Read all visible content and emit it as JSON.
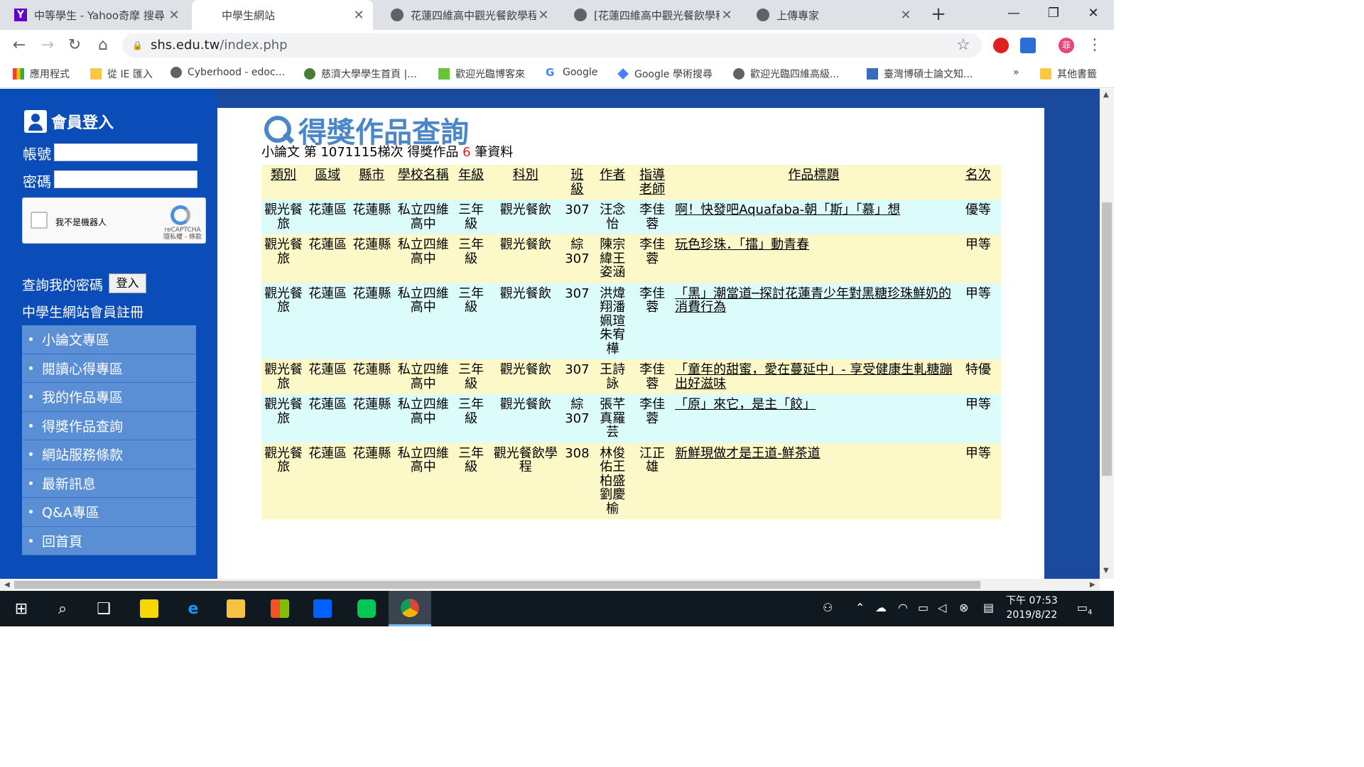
{
  "browser": {
    "tabs": [
      {
        "title": "中等學生 - Yahoo奇摩 搜尋",
        "icon": "yahoo-icon"
      },
      {
        "title": "中學生網站",
        "icon": "none"
      },
      {
        "title": "花蓮四維高中觀光餐飲學程",
        "icon": "globe-icon"
      },
      {
        "title": "[花蓮四維高中觀光餐飲學程",
        "icon": "globe-icon"
      },
      {
        "title": "上傳專家",
        "icon": "globe-icon"
      }
    ],
    "new_tab": "+",
    "url_domain": "shs.edu.tw",
    "url_path": "/index.php",
    "bookmarks": [
      "應用程式",
      "從 IE 匯入",
      "Cyberhood - edoc...",
      "慈濟大學學生首頁 |...",
      "歡迎光臨博客來",
      "Google",
      "Google 學術搜尋",
      "歡迎光臨四維高級...",
      "臺灣博碩士論文知...",
      "其他書籤"
    ],
    "bookmarks_more": "»",
    "profile_initial": "菲"
  },
  "sidebar": {
    "login_title": "會員登入",
    "account_label": "帳號",
    "password_label": "密碼",
    "captcha_text": "我不是機器人",
    "captcha_brand": "reCAPTCHA",
    "captcha_sub": "隱私權 - 條款",
    "forgot_text": "查詢我的密碼",
    "login_button": "登入",
    "register_text": "中學生網站會員註冊",
    "menu": [
      "小論文專區",
      "閱讀心得專區",
      "我的作品專區",
      "得獎作品查詢",
      "網站服務條款",
      "最新訊息",
      "Q&A專區",
      "回首頁"
    ]
  },
  "main": {
    "title": "得獎作品查詢",
    "summary_prefix": "小論文 第 1071115梯次 得獎作品 ",
    "summary_count": "6",
    "summary_suffix": " 筆資料",
    "headers": [
      "類別",
      "區域",
      "縣市",
      "學校名稱",
      "年級",
      "科別",
      "班級",
      "作者",
      "指導老師",
      "作品標題",
      "名次"
    ],
    "rows": [
      {
        "category": "觀光餐旅",
        "area": "花蓮區",
        "county": "花蓮縣",
        "school": "私立四維高中",
        "grade": "三年級",
        "dept": "觀光餐飲",
        "class": "307",
        "authors": "汪念怡",
        "teacher": "李佳蓉",
        "title": "啊！快發吧Aquafaba-朝「斯」「慕」想",
        "rank": "優等"
      },
      {
        "category": "觀光餐旅",
        "area": "花蓮區",
        "county": "花蓮縣",
        "school": "私立四維高中",
        "grade": "三年級",
        "dept": "觀光餐飲",
        "class": "綜307",
        "authors": "陳宗緯王姿涵",
        "teacher": "李佳蓉",
        "title": "玩色珍珠．「擂」動青春",
        "rank": "甲等"
      },
      {
        "category": "觀光餐旅",
        "area": "花蓮區",
        "county": "花蓮縣",
        "school": "私立四維高中",
        "grade": "三年級",
        "dept": "觀光餐飲",
        "class": "307",
        "authors": "洪煒翔潘姵瑄朱宥樺",
        "teacher": "李佳蓉",
        "title": "「黑」潮當道─探討花蓮青少年對黑糖珍珠鮮奶的消費行為",
        "rank": "甲等"
      },
      {
        "category": "觀光餐旅",
        "area": "花蓮區",
        "county": "花蓮縣",
        "school": "私立四維高中",
        "grade": "三年級",
        "dept": "觀光餐飲",
        "class": "307",
        "authors": "王詩詠",
        "teacher": "李佳蓉",
        "title": "「童年的甜蜜，愛在蔓延中」- 享受健康生軋糖蹦出好滋味",
        "rank": "特優"
      },
      {
        "category": "觀光餐旅",
        "area": "花蓮區",
        "county": "花蓮縣",
        "school": "私立四維高中",
        "grade": "三年級",
        "dept": "觀光餐飲",
        "class": "綜307",
        "authors": "張芊真羅芸",
        "teacher": "李佳蓉",
        "title": "「原」來它，是主「餃」",
        "rank": "甲等"
      },
      {
        "category": "觀光餐旅",
        "area": "花蓮區",
        "county": "花蓮縣",
        "school": "私立四維高中",
        "grade": "三年級",
        "dept": "觀光餐飲學程",
        "class": "308",
        "authors": "林俊佑王柏盛劉慶榆",
        "teacher": "江正雄",
        "title": "新鮮現做才是王道-鮮茶道",
        "rank": "甲等"
      }
    ]
  },
  "taskbar": {
    "time": "下午 07:53",
    "date": "2019/8/22",
    "notification_count": "4"
  }
}
